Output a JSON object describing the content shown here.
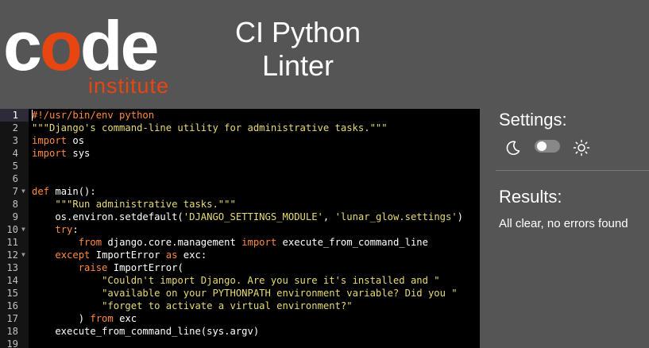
{
  "header": {
    "logo": {
      "word": "code",
      "subword": "institute"
    },
    "title_line1": "CI Python",
    "title_line2": "Linter"
  },
  "editor": {
    "active_line": 1,
    "lines": [
      {
        "n": "1",
        "fold": false
      },
      {
        "n": "2",
        "fold": false
      },
      {
        "n": "3",
        "fold": false
      },
      {
        "n": "4",
        "fold": false
      },
      {
        "n": "5",
        "fold": false
      },
      {
        "n": "6",
        "fold": false
      },
      {
        "n": "7",
        "fold": true
      },
      {
        "n": "8",
        "fold": false
      },
      {
        "n": "9",
        "fold": false
      },
      {
        "n": "10",
        "fold": true
      },
      {
        "n": "11",
        "fold": false
      },
      {
        "n": "12",
        "fold": true
      },
      {
        "n": "13",
        "fold": false
      },
      {
        "n": "14",
        "fold": false
      },
      {
        "n": "15",
        "fold": false
      },
      {
        "n": "16",
        "fold": false
      },
      {
        "n": "17",
        "fold": false
      },
      {
        "n": "18",
        "fold": false
      },
      {
        "n": "19",
        "fold": false
      }
    ],
    "code": {
      "l1": "#!/usr/bin/env python",
      "l2": "\"\"\"Django's command-line utility for administrative tasks.\"\"\"",
      "l3_kw": "import",
      "l3_rest": " os",
      "l4_kw": "import",
      "l4_rest": " sys",
      "l7_kw": "def",
      "l7_rest": " main():",
      "l8_indent": "    ",
      "l8_str": "\"\"\"Run administrative tasks.\"\"\"",
      "l9_a": "    os.environ.setdefault(",
      "l9_s1": "'DJANGO_SETTINGS_MODULE'",
      "l9_b": ", ",
      "l9_s2": "'lunar_glow.settings'",
      "l9_c": ")",
      "l10_indent": "    ",
      "l10_kw": "try",
      "l10_rest": ":",
      "l11_indent": "        ",
      "l11_kw1": "from",
      "l11_mid": " django.core.management ",
      "l11_kw2": "import",
      "l11_rest": " execute_from_command_line",
      "l12_indent": "    ",
      "l12_kw1": "except",
      "l12_mid": " ImportError ",
      "l12_kw2": "as",
      "l12_rest": " exc:",
      "l13_indent": "        ",
      "l13_kw": "raise",
      "l13_rest": " ImportError(",
      "l14_indent": "            ",
      "l14_str": "\"Couldn't import Django. Are you sure it's installed and \"",
      "l15_indent": "            ",
      "l15_str": "\"available on your PYTHONPATH environment variable? Did you \"",
      "l16_indent": "            ",
      "l16_str": "\"forget to activate a virtual environment?\"",
      "l17_a": "        ) ",
      "l17_kw": "from",
      "l17_rest": " exc",
      "l18": "    execute_from_command_line(sys.argv)"
    }
  },
  "settings": {
    "title": "Settings:",
    "theme_toggle": "off"
  },
  "results": {
    "title": "Results:",
    "message": "All clear, no errors found"
  },
  "colors": {
    "background": "#555555",
    "editor_bg": "#000000",
    "brand_orange": "#e84610",
    "keyword": "#ff8a3d",
    "string": "#e6db74"
  }
}
